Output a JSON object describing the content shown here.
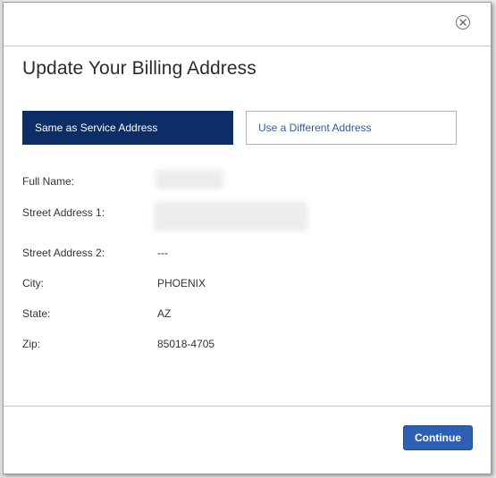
{
  "modal": {
    "title": "Update Your Billing Address",
    "close_icon": "close-circle-icon"
  },
  "address_toggle": {
    "selected": "same",
    "same_label": "Same as Service Address",
    "different_label": "Use a Different Address"
  },
  "fields": {
    "full_name": {
      "label": "Full Name:",
      "value": ""
    },
    "street1": {
      "label": "Street Address 1:",
      "value": ""
    },
    "street2": {
      "label": "Street Address 2:",
      "value": "---"
    },
    "city": {
      "label": "City:",
      "value": "PHOENIX"
    },
    "state": {
      "label": "State:",
      "value": "AZ"
    },
    "zip": {
      "label": "Zip:",
      "value": "85018-4705"
    }
  },
  "footer": {
    "continue_label": "Continue"
  },
  "colors": {
    "primary_dark": "#0c2d66",
    "button_blue": "#2f5fb3",
    "link_blue": "#2f5ea3"
  }
}
